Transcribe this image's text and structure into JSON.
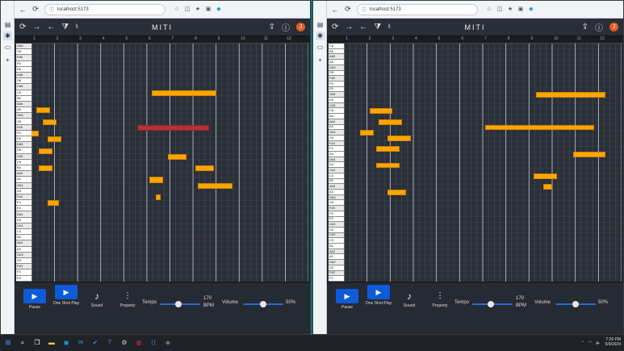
{
  "browser": {
    "url": "localhost:5173"
  },
  "app": {
    "title": "MITI"
  },
  "windows": [
    {
      "id": "left",
      "ruler": [
        "1",
        "2",
        "3",
        "4",
        "5",
        "6",
        "7",
        "8",
        "9",
        "10",
        "11",
        "12"
      ],
      "keys": [
        "G#6",
        "G6",
        "F#6",
        "F6",
        "E6",
        "D#6",
        "D6",
        "C#6",
        "C6",
        "B5",
        "A#5",
        "A5",
        "G#5",
        "G5",
        "F#5",
        "F5",
        "E5",
        "D#5",
        "D5",
        "C#5",
        "C5",
        "B4",
        "A#4",
        "A4",
        "G#4",
        "G4",
        "F#4",
        "F4",
        "E4",
        "D#4",
        "D4",
        "C#4",
        "C4",
        "B3",
        "A#3",
        "A3",
        "G#3",
        "G3",
        "F#3",
        "F3",
        "E3"
      ],
      "notes": [
        {
          "row": 8,
          "start": 5.2,
          "dur": 2.8
        },
        {
          "row": 11,
          "start": 0.2,
          "dur": 0.6
        },
        {
          "row": 13,
          "start": 0.5,
          "dur": 0.6
        },
        {
          "row": 14,
          "start": 4.6,
          "dur": 3.1,
          "sel": true
        },
        {
          "row": 15,
          "start": -0.1,
          "dur": 0.4
        },
        {
          "row": 16,
          "start": 0.7,
          "dur": 0.6
        },
        {
          "row": 18,
          "start": 0.3,
          "dur": 0.6
        },
        {
          "row": 19,
          "start": 5.9,
          "dur": 0.8
        },
        {
          "row": 21,
          "start": 0.3,
          "dur": 0.6
        },
        {
          "row": 21,
          "start": 7.1,
          "dur": 0.8
        },
        {
          "row": 23,
          "start": 5.1,
          "dur": 0.6
        },
        {
          "row": 24,
          "start": 7.2,
          "dur": 1.5
        },
        {
          "row": 26,
          "start": 5.4,
          "dur": 0.2
        },
        {
          "row": 27,
          "start": 0.7,
          "dur": 0.5
        }
      ]
    },
    {
      "id": "right",
      "ruler": [
        "1",
        "2",
        "3",
        "4",
        "5",
        "6",
        "7",
        "8",
        "9",
        "10",
        "11",
        "12"
      ],
      "keys": [
        "C6",
        "B5",
        "A#5",
        "A5",
        "G#5",
        "G5",
        "F#5",
        "F5",
        "E5",
        "D#5",
        "D5",
        "C#5",
        "C5",
        "B4",
        "A#4",
        "A4",
        "G#4",
        "G4",
        "F#4",
        "F4",
        "E4",
        "D#4",
        "D4",
        "C#4",
        "C4",
        "B3",
        "A#3",
        "A3",
        "G#3",
        "G3",
        "F#3",
        "F3",
        "E3",
        "D#3",
        "D3",
        "C#3",
        "C3",
        "B2",
        "A#2",
        "A2",
        "G#2",
        "G2",
        "F#2",
        "F2"
      ],
      "notes": [
        {
          "row": 9,
          "start": 8.3,
          "dur": 3.0
        },
        {
          "row": 12,
          "start": 1.1,
          "dur": 1.0
        },
        {
          "row": 14,
          "start": 1.5,
          "dur": 1.0
        },
        {
          "row": 15,
          "start": 6.1,
          "dur": 4.7
        },
        {
          "row": 16,
          "start": 0.7,
          "dur": 0.6
        },
        {
          "row": 17,
          "start": 1.9,
          "dur": 1.0
        },
        {
          "row": 19,
          "start": 1.4,
          "dur": 1.0
        },
        {
          "row": 20,
          "start": 9.9,
          "dur": 1.4
        },
        {
          "row": 22,
          "start": 1.4,
          "dur": 1.0
        },
        {
          "row": 24,
          "start": 8.2,
          "dur": 1.0
        },
        {
          "row": 26,
          "start": 8.6,
          "dur": 0.4
        },
        {
          "row": 27,
          "start": 1.9,
          "dur": 0.8
        }
      ]
    }
  ],
  "controls": {
    "pause": "Pause",
    "oneshot": "One Shot Play",
    "sound": "Sound",
    "property": "Property",
    "tempo_label": "Tempo",
    "tempo_value": "170",
    "tempo_unit": "BPM",
    "volume_label": "Volume",
    "volume_value": "50%",
    "tempo_level": 0.45,
    "volume_level": 0.5
  },
  "taskbar": {
    "time": "7:26 PM",
    "date": "9/9/2024"
  }
}
